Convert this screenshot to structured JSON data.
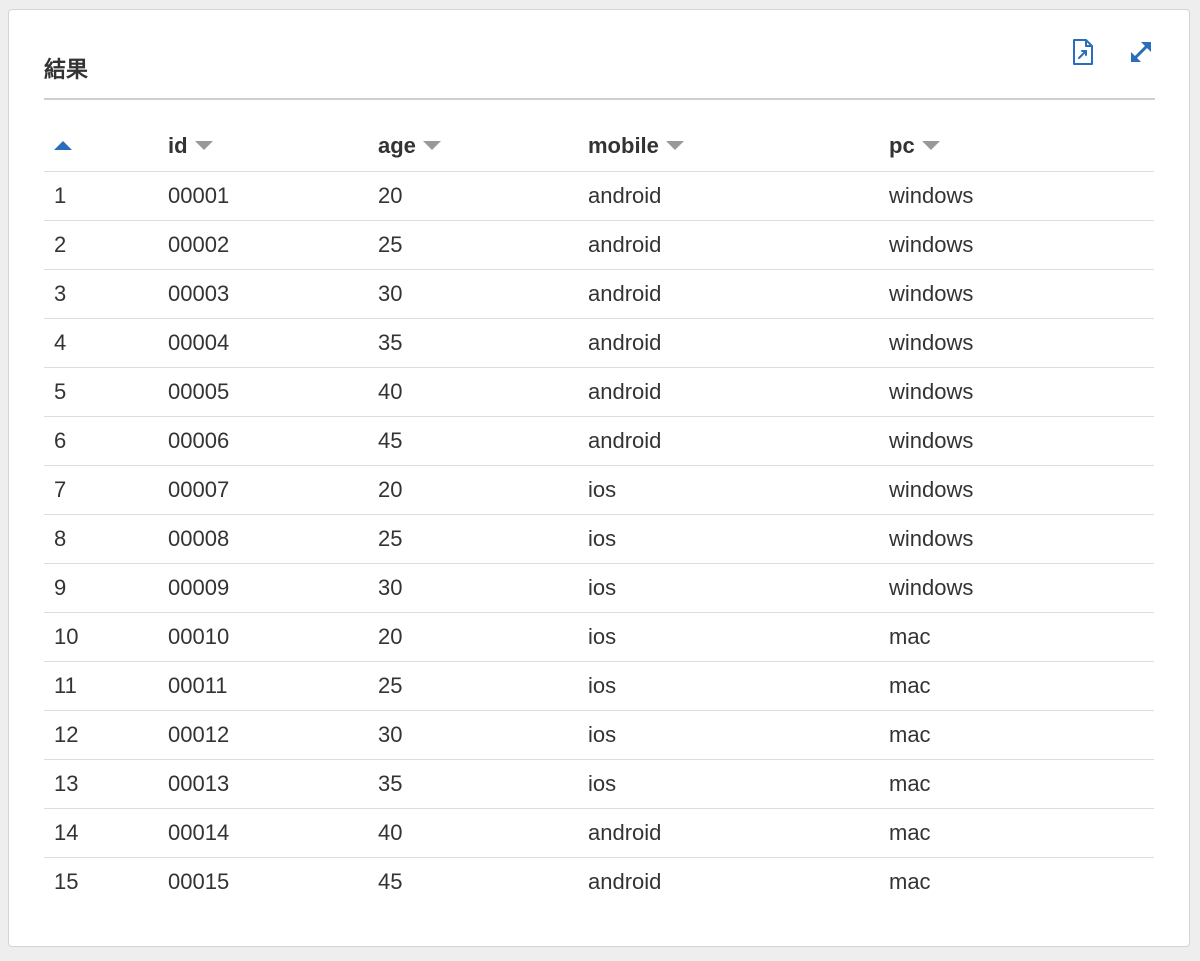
{
  "panel": {
    "title": "結果",
    "tools": {
      "export_icon": "file-export-icon",
      "expand_icon": "expand-arrows-icon"
    }
  },
  "colors": {
    "accent": "#2a6ebb",
    "muted_caret": "#999999"
  },
  "table": {
    "columns": [
      {
        "key": "index",
        "label": "",
        "sort": "asc"
      },
      {
        "key": "id",
        "label": "id",
        "sort": "none"
      },
      {
        "key": "age",
        "label": "age",
        "sort": "none"
      },
      {
        "key": "mobile",
        "label": "mobile",
        "sort": "none"
      },
      {
        "key": "pc",
        "label": "pc",
        "sort": "none"
      }
    ],
    "rows": [
      [
        "1",
        "00001",
        "20",
        "android",
        "windows"
      ],
      [
        "2",
        "00002",
        "25",
        "android",
        "windows"
      ],
      [
        "3",
        "00003",
        "30",
        "android",
        "windows"
      ],
      [
        "4",
        "00004",
        "35",
        "android",
        "windows"
      ],
      [
        "5",
        "00005",
        "40",
        "android",
        "windows"
      ],
      [
        "6",
        "00006",
        "45",
        "android",
        "windows"
      ],
      [
        "7",
        "00007",
        "20",
        "ios",
        "windows"
      ],
      [
        "8",
        "00008",
        "25",
        "ios",
        "windows"
      ],
      [
        "9",
        "00009",
        "30",
        "ios",
        "windows"
      ],
      [
        "10",
        "00010",
        "20",
        "ios",
        "mac"
      ],
      [
        "11",
        "00011",
        "25",
        "ios",
        "mac"
      ],
      [
        "12",
        "00012",
        "30",
        "ios",
        "mac"
      ],
      [
        "13",
        "00013",
        "35",
        "ios",
        "mac"
      ],
      [
        "14",
        "00014",
        "40",
        "android",
        "mac"
      ],
      [
        "15",
        "00015",
        "45",
        "android",
        "mac"
      ]
    ]
  }
}
